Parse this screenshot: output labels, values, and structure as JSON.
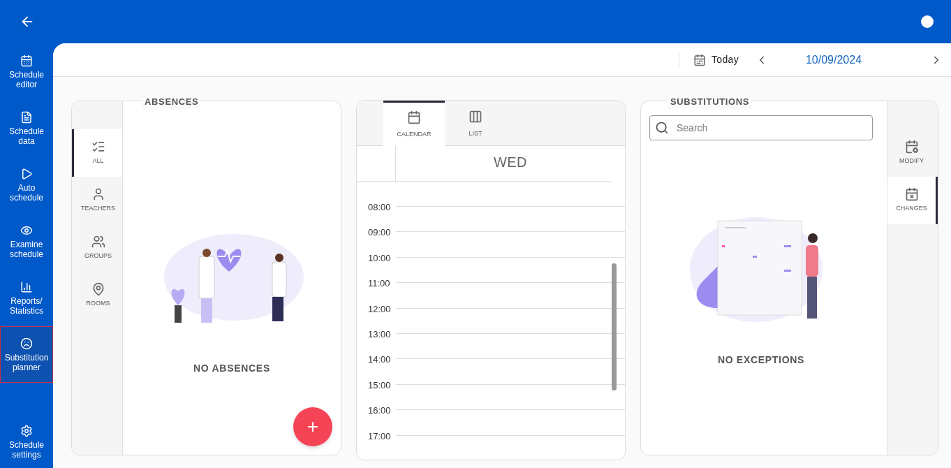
{
  "sidebar": {
    "items": [
      {
        "label": "Schedule editor",
        "kind": "editor",
        "selected": false
      },
      {
        "label": "Schedule data",
        "kind": "data",
        "selected": false
      },
      {
        "label": "Auto schedule",
        "kind": "auto",
        "selected": false
      },
      {
        "label": "Examine schedule",
        "kind": "examine",
        "selected": false
      },
      {
        "label": "Reports/ Statistics",
        "kind": "reports",
        "selected": false
      },
      {
        "label": "Substitution planner",
        "kind": "substitution",
        "selected": true
      }
    ],
    "footer": {
      "label": "Schedule settings"
    }
  },
  "toolbar": {
    "today": "Today",
    "date": "10/09/2024"
  },
  "absences": {
    "title": "ABSENCES",
    "tabs": [
      {
        "label": "ALL",
        "kind": "all",
        "selected": true
      },
      {
        "label": "TEACHERS",
        "kind": "teachers",
        "selected": false
      },
      {
        "label": "GROUPS",
        "kind": "groups",
        "selected": false
      },
      {
        "label": "ROOMS",
        "kind": "rooms",
        "selected": false
      }
    ],
    "empty": "NO ABSENCES",
    "fab": "+"
  },
  "calendar": {
    "tabs": [
      {
        "label": "CALENDAR",
        "kind": "calendar",
        "selected": true
      },
      {
        "label": "LIST",
        "kind": "list",
        "selected": false
      }
    ],
    "day": "WED",
    "hours": [
      "08:00",
      "09:00",
      "10:00",
      "11:00",
      "12:00",
      "13:00",
      "14:00",
      "15:00",
      "16:00",
      "17:00"
    ]
  },
  "substitutions": {
    "title": "SUBSTITUTIONS",
    "search": {
      "placeholder": "Search"
    },
    "empty": "NO EXCEPTIONS",
    "tabs": [
      {
        "label": "MODIFY",
        "kind": "modify",
        "selected": false
      },
      {
        "label": "CHANGES",
        "kind": "changes",
        "selected": true
      }
    ]
  }
}
